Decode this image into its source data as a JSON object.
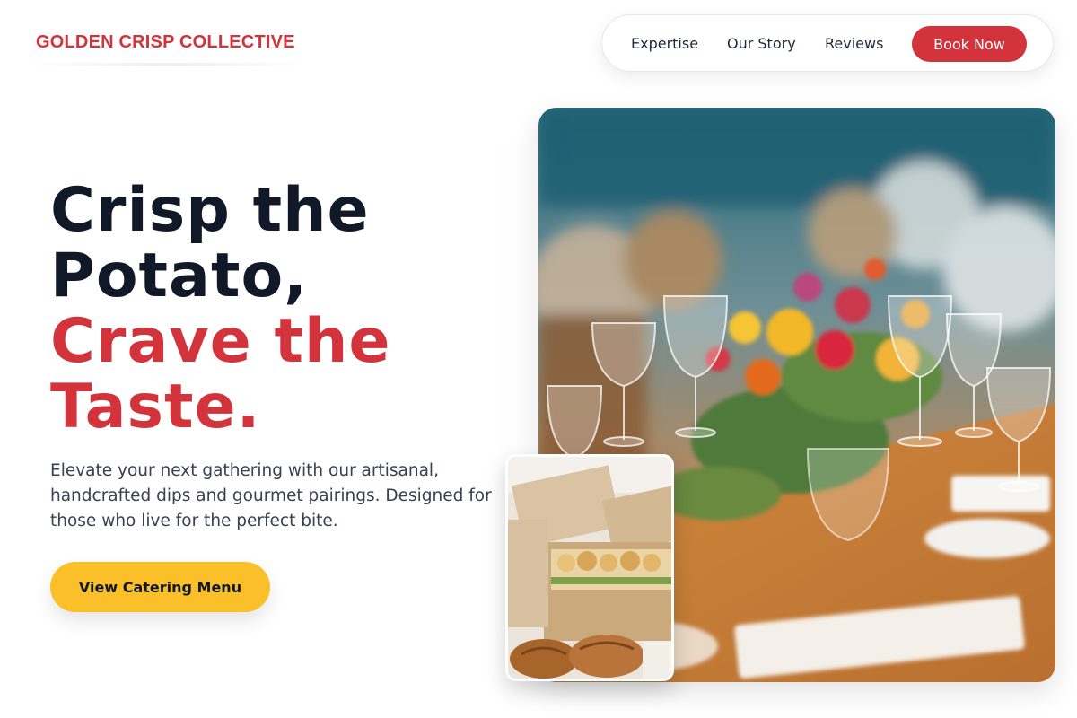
{
  "brand": {
    "name": "GOLDEN CRISP COLLECTIVE",
    "color": "#d3333a"
  },
  "nav": {
    "links": [
      {
        "label": "Expertise"
      },
      {
        "label": "Our Story"
      },
      {
        "label": "Reviews"
      }
    ],
    "cta_label": "Book Now",
    "cta_color": "#d3333a"
  },
  "hero": {
    "headline_line1": "Crisp the",
    "headline_line2": "Potato,",
    "headline_line3": "Crave the",
    "headline_line4": "Taste.",
    "subtext": "Elevate your next gathering with our artisanal, handcrafted dips and gourmet pairings. Designed for those who live for the perfect bite.",
    "cta_label": "View Catering Menu",
    "cta_color": "#fbbf2a"
  },
  "images": {
    "main": "banquet-table-with-flowers-and-wine-glasses",
    "thumbnail": "boxed-sandwiches-and-croissants"
  }
}
